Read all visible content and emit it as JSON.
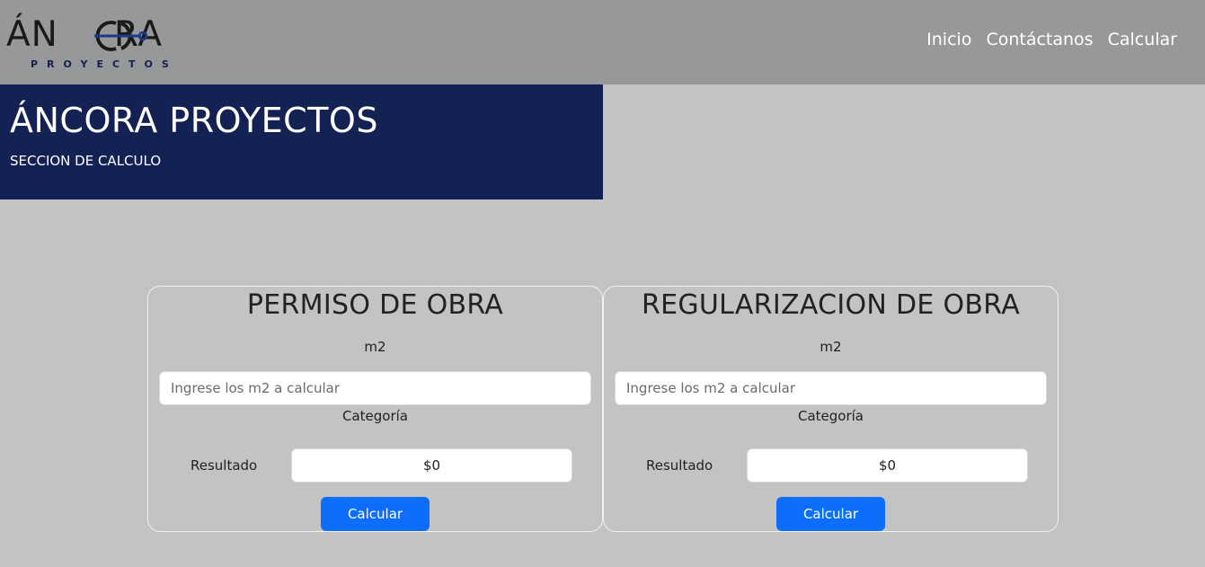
{
  "brand": {
    "logo_text": "ÁN    RA",
    "logo_sub": "PROYECTOS"
  },
  "nav": {
    "items": [
      {
        "label": "Inicio"
      },
      {
        "label": "Contáctanos"
      },
      {
        "label": "Calcular"
      }
    ]
  },
  "hero": {
    "title": "ÁNCORA PROYECTOS",
    "subtitle": "SECCION DE CALCULO"
  },
  "cards": [
    {
      "title": "PERMISO DE OBRA",
      "m2_label": "m2",
      "input_placeholder": "Ingrese los m2 a calcular",
      "category_label": "Categoría",
      "result_label": "Resultado",
      "result_value": "$0",
      "button_label": "Calcular"
    },
    {
      "title": "REGULARIZACION DE OBRA",
      "m2_label": "m2",
      "input_placeholder": "Ingrese los m2 a calcular",
      "category_label": "Categoría",
      "result_label": "Resultado",
      "result_value": "$0",
      "button_label": "Calcular"
    }
  ],
  "colors": {
    "navbar": "#97989a",
    "hero": "#132253",
    "background": "#c3c3c3",
    "button": "#0d6efd"
  }
}
